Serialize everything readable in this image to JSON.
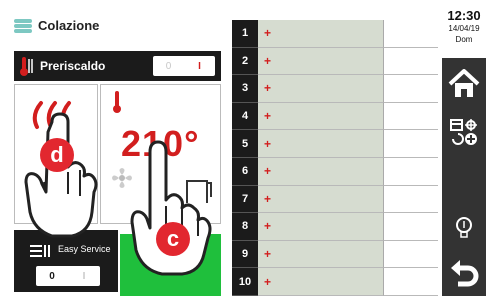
{
  "header": {
    "title": "Colazione"
  },
  "preheat": {
    "label": "Preriscaldo",
    "toggle_off": "0",
    "toggle_on": "I"
  },
  "temperature": {
    "value": "210°"
  },
  "easy_service": {
    "label": "Easy Service",
    "toggle_off": "0",
    "toggle_on": "I"
  },
  "table": {
    "rows": [
      {
        "num": "1",
        "name": "+"
      },
      {
        "num": "2",
        "name": "+"
      },
      {
        "num": "3",
        "name": "+"
      },
      {
        "num": "4",
        "name": "+"
      },
      {
        "num": "5",
        "name": "+"
      },
      {
        "num": "6",
        "name": "+"
      },
      {
        "num": "7",
        "name": "+"
      },
      {
        "num": "8",
        "name": "+"
      },
      {
        "num": "9",
        "name": "+"
      },
      {
        "num": "10",
        "name": "+"
      }
    ]
  },
  "status": {
    "time": "12:30",
    "date": "14/04/19",
    "day": "Dom"
  },
  "sidebar": {
    "icons": [
      "home-icon",
      "settings-schedule-icon",
      "lightbulb-icon",
      "back-icon"
    ]
  },
  "overlays": {
    "badge_d": "d",
    "badge_c": "c"
  },
  "colors": {
    "accent_red": "#d21e1e",
    "green": "#1fbf3c",
    "dark": "#1b1b1b",
    "table_fill": "#d6dcd0"
  }
}
